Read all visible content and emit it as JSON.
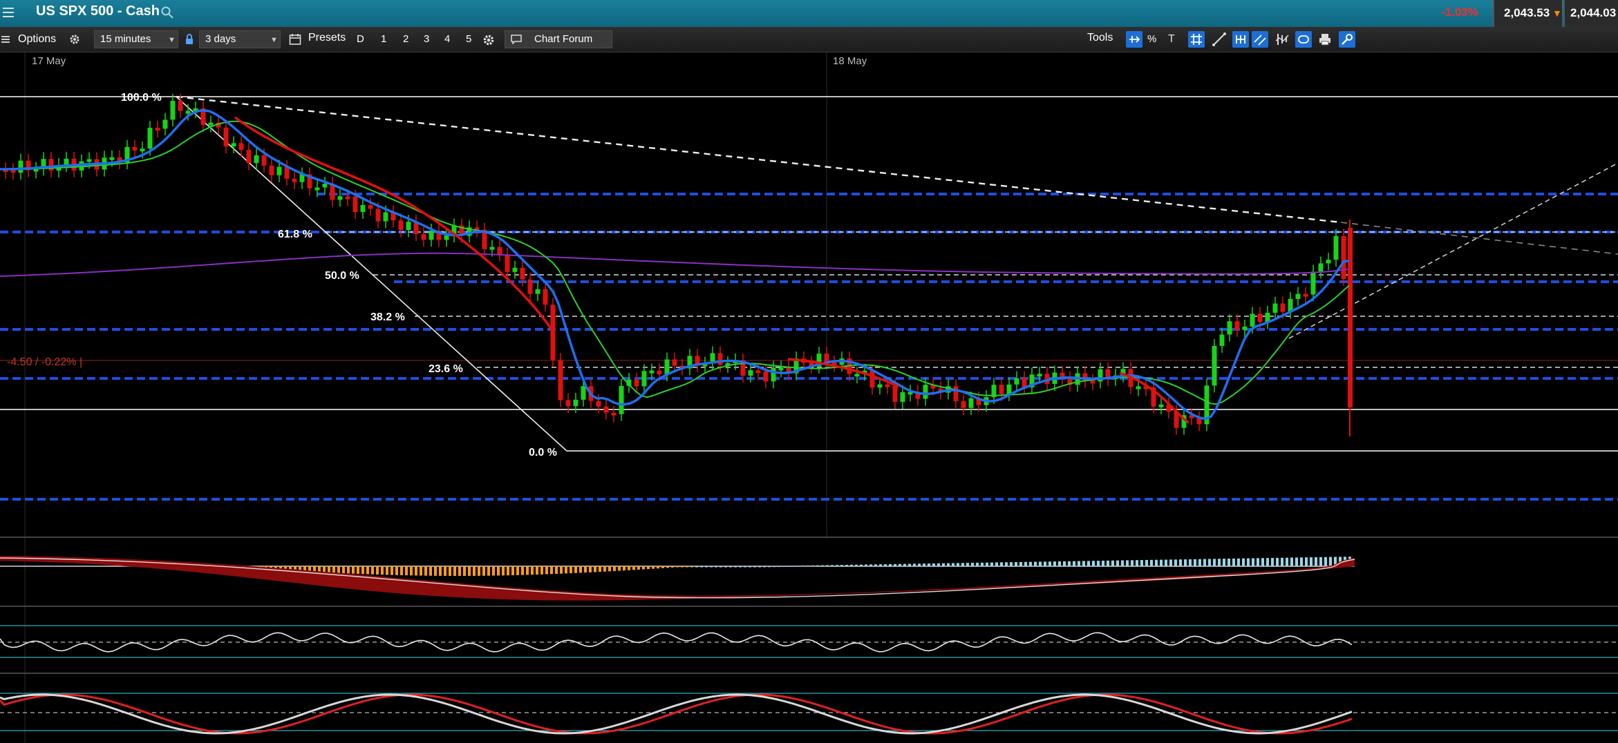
{
  "header": {
    "title": "US SPX 500 - Cash",
    "change": "-1.03%",
    "sell": "2,043.53",
    "buy": "2,044.03"
  },
  "toolbar": {
    "options": "Options",
    "interval": "15 minutes",
    "range": "3 days",
    "presets": "Presets",
    "preset_buttons": [
      "D",
      "1",
      "2",
      "3",
      "4",
      "5"
    ],
    "chart_forum": "Chart Forum",
    "tools": "Tools",
    "percent": "%",
    "text_tool": "T"
  },
  "chart": {
    "dates": [
      "17 May",
      "18 May"
    ],
    "fib_levels": [
      "100.0 %",
      "61.8 %",
      "50.0 %",
      "38.2 %",
      "23.6 %",
      "0.0 %"
    ],
    "change_label": "-4.50 / -0.22% |",
    "colors": {
      "up": "#17d417",
      "down": "#e01010",
      "blue_dash": "#1f4fe0",
      "ema_fast": "#1e6ff0",
      "ema_slow": "#2bd02b",
      "purple": "#8a2fc4"
    }
  }
}
